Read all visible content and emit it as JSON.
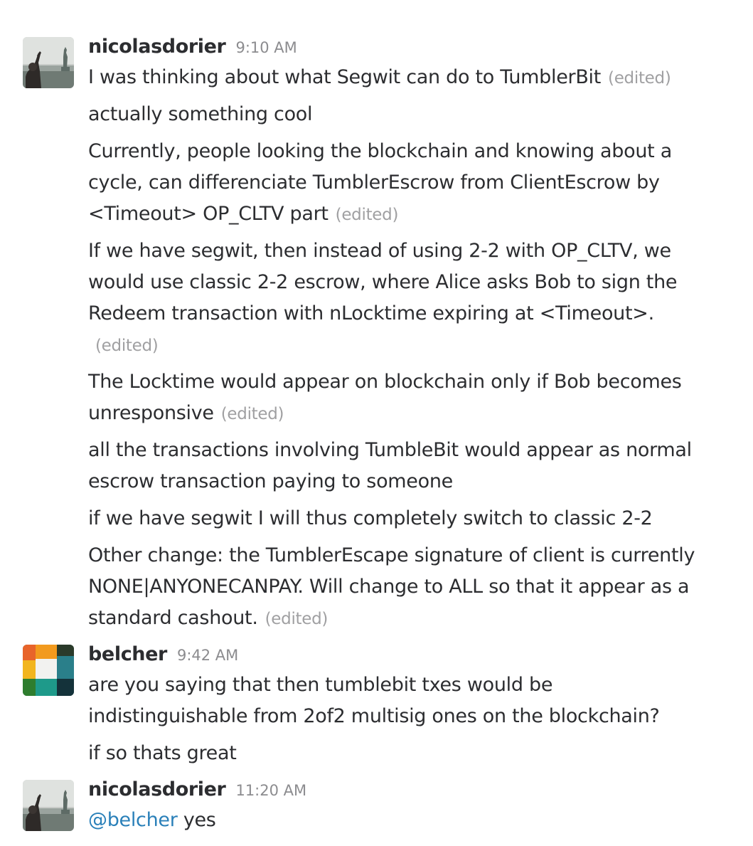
{
  "messages_group_1": {
    "sender": "nicolasdorier",
    "time": "9:10 AM",
    "avatar_icon": "statue-of-liberty-photo-avatar",
    "lines": [
      {
        "text": "I was thinking about what Segwit can do to TumblerBit",
        "edited": "(edited)"
      },
      {
        "text": "actually something cool"
      },
      {
        "text": "Currently, people looking the blockchain and knowing about a cycle, can differenciate TumblerEscrow from ClientEscrow by <Timeout> OP_CLTV part",
        "edited": "(edited)"
      },
      {
        "text": "If we have segwit, then instead of using 2-2 with OP_CLTV, we would use classic 2-2 escrow, where Alice asks Bob to sign the Redeem transaction with nLocktime expiring at <Timeout>.",
        "edited": "(edited)"
      },
      {
        "text": "The Locktime would appear on blockchain only if Bob becomes unresponsive",
        "edited": "(edited)"
      },
      {
        "text": "all the transactions involving TumbleBit would appear as normal escrow transaction paying to someone"
      },
      {
        "text": "if we have segwit I will thus completely switch to classic 2-2"
      },
      {
        "text": "Other change: the TumblerEscape signature of client is currently NONE|ANYONECANPAY. Will change to ALL so that it appear as a standard cashout.",
        "edited": "(edited)"
      }
    ]
  },
  "messages_group_2": {
    "sender": "belcher",
    "time": "9:42 AM",
    "avatar_icon": "colorful-mosaic-avatar",
    "lines": [
      {
        "text": "are you saying that then tumblebit txes would be indistinguishable from 2of2 multisig ones on the blockchain?"
      },
      {
        "text": "if so thats great"
      }
    ]
  },
  "messages_group_3": {
    "sender": "nicolasdorier",
    "time": "11:20 AM",
    "avatar_icon": "statue-of-liberty-photo-avatar",
    "mention": "@belcher",
    "text": " yes"
  }
}
